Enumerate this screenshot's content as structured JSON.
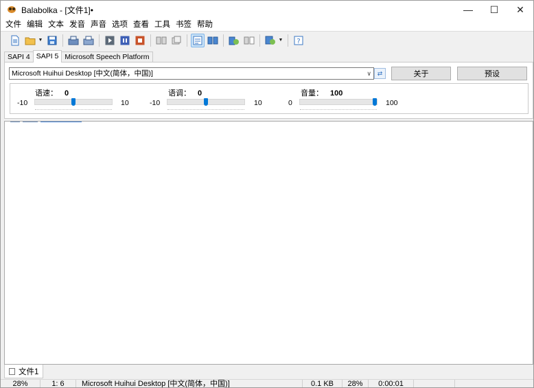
{
  "window": {
    "title": "Balabolka - [文件1]•",
    "controls": {
      "minimize": "—",
      "maximize": "☐",
      "close": "✕"
    }
  },
  "menu": [
    "文件",
    "编辑",
    "文本",
    "发音",
    "声音",
    "选项",
    "查看",
    "工具",
    "书签",
    "帮助"
  ],
  "toolbar": {
    "buttons": [
      "new-file-icon",
      "open-folder-icon",
      "dropdown-arrow",
      "save-icon",
      "read-aloud-icon",
      "read-selection-icon",
      "play-icon",
      "pause-icon",
      "stop-icon",
      "split-file-icon",
      "batch-convert-icon",
      "dictionary-icon",
      "word-spell-icon",
      "clipboard-read-icon",
      "clipboard-watch-icon",
      "voice-settings-icon",
      "dropdown-arrow",
      "help-icon"
    ]
  },
  "tabs": [
    {
      "label": "SAPI 4",
      "active": false
    },
    {
      "label": "SAPI 5",
      "active": true
    },
    {
      "label": "Microsoft Speech Platform",
      "active": false
    }
  ],
  "voice": {
    "selected": "Microsoft Huihui Desktop [中文(简体，中国)]",
    "about_button": "关于",
    "preset_button": "预设"
  },
  "params": {
    "rate": {
      "label": "语速：",
      "value": "0",
      "min": "-10",
      "max": "10",
      "level": 0.5
    },
    "pitch": {
      "label": "语调：",
      "value": "0",
      "min": "-10",
      "max": "10",
      "level": 0.5
    },
    "volume": {
      "label": "音量：",
      "value": "100",
      "min": "0",
      "max": "100",
      "level": 1.0
    }
  },
  "document_tab": {
    "label": "文件1"
  },
  "status": {
    "zoom": "28%",
    "position": "1:  6",
    "voice": "Microsoft Huihui Desktop [中文(简体，中国)]",
    "size": "0.1 KB",
    "progress": "28%",
    "time": "0:00:01"
  },
  "colors": {
    "accent": "#0078d7",
    "active_toolbar": "#cce4f7"
  }
}
